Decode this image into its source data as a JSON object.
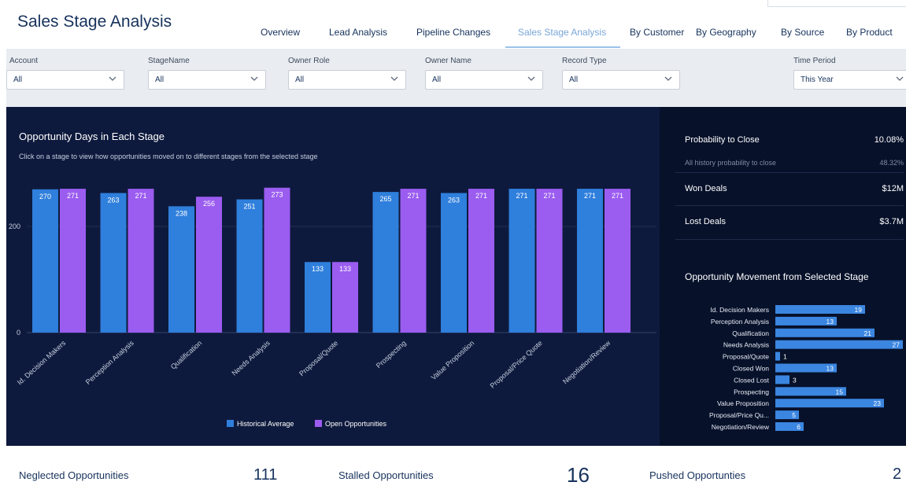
{
  "header": {
    "title": "Sales Stage Analysis",
    "tabs": [
      {
        "label": "Overview",
        "active": false
      },
      {
        "label": "Lead Analysis",
        "active": false
      },
      {
        "label": "Pipeline Changes",
        "active": false
      },
      {
        "label": "Sales Stage Analysis",
        "active": true
      },
      {
        "label": "By Customer",
        "active": false
      },
      {
        "label": "By Geography",
        "active": false
      },
      {
        "label": "By Source",
        "active": false
      },
      {
        "label": "By Product",
        "active": false
      }
    ]
  },
  "filters": [
    {
      "label": "Account",
      "value": "All"
    },
    {
      "label": "StageName",
      "value": "All"
    },
    {
      "label": "Owner Role",
      "value": "All"
    },
    {
      "label": "Owner Name",
      "value": "All"
    },
    {
      "label": "Record Type",
      "value": "All"
    },
    {
      "label": "Time Period",
      "value": "This Year"
    }
  ],
  "main_chart": {
    "title": "Opportunity Days in Each Stage",
    "subtitle": "Click on a stage to view how opportunities moved on to different stages from the selected stage"
  },
  "side": {
    "probability_label": "Probability to Close",
    "probability_value": "10.08%",
    "history_label": "All history probability to close",
    "history_value": "48.32%",
    "won_label": "Won Deals",
    "won_value": "$12M",
    "lost_label": "Lost Deals",
    "lost_value": "$3.7M",
    "movement_title": "Opportunity Movement from Selected Stage"
  },
  "footer": {
    "neglected_label": "Neglected Opportunities",
    "neglected_value": "111",
    "stalled_label": "Stalled Opportunities",
    "stalled_value": "16",
    "pushed_label": "Pushed Opportunties",
    "pushed_value": "2"
  },
  "colors": {
    "historical": "#2f7fdc",
    "open": "#9b5cf0",
    "movement_bar": "#3b86e0",
    "panel": "#0e1a3d"
  },
  "chart_data": [
    {
      "type": "bar",
      "title": "Opportunity Days in Each Stage",
      "categories": [
        "Id. Decision Makers",
        "Perception Analysis",
        "Qualification",
        "Needs Analysis",
        "Proposal/Quote",
        "Prospecting",
        "Value Proposition",
        "Proposal/Price Quote",
        "Negotiation/Review"
      ],
      "series": [
        {
          "name": "Historical Average",
          "values": [
            270,
            263,
            238,
            251,
            133,
            265,
            263,
            271,
            271
          ]
        },
        {
          "name": "Open Opportunities",
          "values": [
            271,
            271,
            256,
            273,
            133,
            271,
            271,
            271,
            271
          ]
        }
      ],
      "yticks": [
        0,
        200
      ],
      "ylim": [
        0,
        280
      ],
      "legend": "bottom-center"
    },
    {
      "type": "bar",
      "orientation": "horizontal",
      "title": "Opportunity Movement from Selected Stage",
      "categories": [
        "Id. Decision Makers",
        "Perception Analysis",
        "Qualification",
        "Needs Analysis",
        "Proposal/Quote",
        "Closed Won",
        "Closed Lost",
        "Prospecting",
        "Value Proposition",
        "Proposal/Price Qu...",
        "Negotiation/Review"
      ],
      "values": [
        19,
        13,
        21,
        27,
        1,
        13,
        3,
        15,
        23,
        5,
        6
      ],
      "xlim": [
        0,
        27
      ]
    }
  ]
}
